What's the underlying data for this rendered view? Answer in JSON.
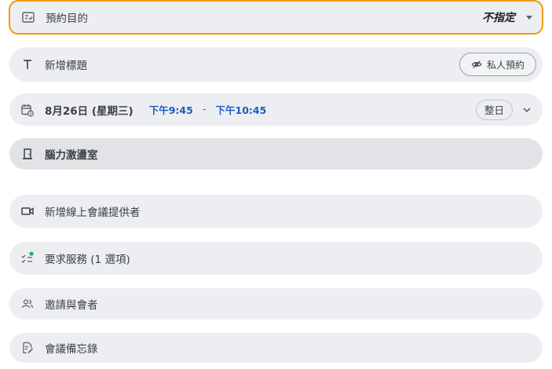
{
  "purpose": {
    "label": "預約目的",
    "value": "不指定"
  },
  "title": {
    "placeholder": "新增標題",
    "private_label": "私人預約"
  },
  "datetime": {
    "date": "8月26日 (星期三)",
    "start": "下午9:45",
    "separator": "-",
    "end": "下午10:45",
    "allday_label": "整日"
  },
  "room": {
    "name": "腦力激盪室"
  },
  "video": {
    "label": "新增線上會議提供者"
  },
  "services": {
    "label": "要求服務 (1 選項)"
  },
  "guests": {
    "label": "邀請與會者"
  },
  "notes": {
    "label": "會議備忘錄"
  },
  "colors": {
    "accent_border": "#f29900",
    "link_blue": "#1a5fc2",
    "service_dot": "#34a853"
  }
}
